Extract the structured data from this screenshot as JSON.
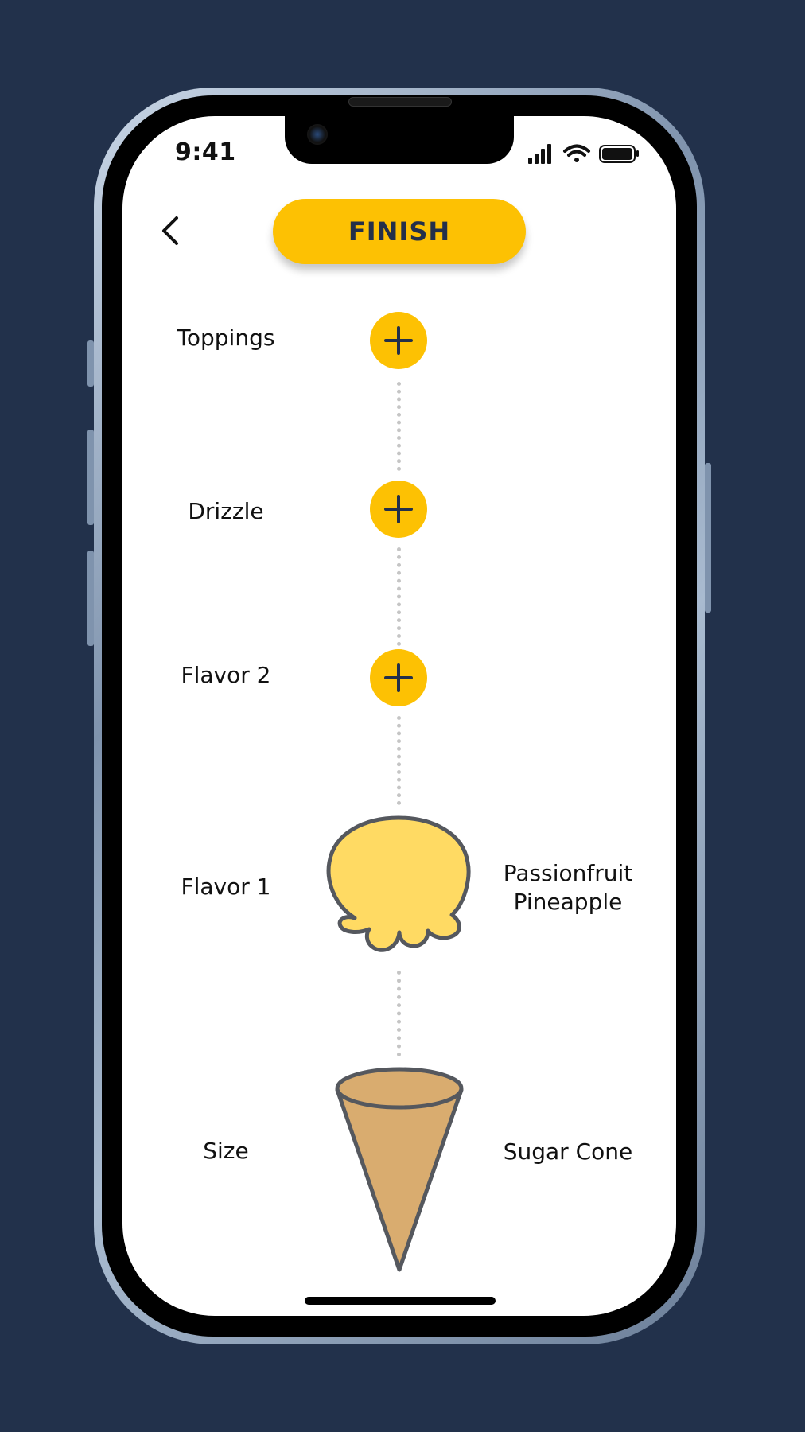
{
  "status_bar": {
    "time": "9:41"
  },
  "header": {
    "finish_label": "FINISH"
  },
  "steps": [
    {
      "label": "Toppings",
      "value": ""
    },
    {
      "label": "Drizzle",
      "value": ""
    },
    {
      "label": "Flavor 2",
      "value": ""
    },
    {
      "label": "Flavor 1",
      "value_line1": "Passionfruit",
      "value_line2": "Pineapple"
    },
    {
      "label": "Size",
      "value": "Sugar Cone"
    }
  ],
  "colors": {
    "background": "#22314b",
    "accent": "#fdc103",
    "accent_text": "#23304a",
    "scoop": "#ffda63",
    "cone": "#d9ac6f",
    "outline": "#55585e"
  },
  "icons": {
    "back": "chevron-left-icon",
    "add": "plus-icon",
    "scoop": "ice-cream-scoop-icon",
    "cone": "sugar-cone-icon"
  }
}
